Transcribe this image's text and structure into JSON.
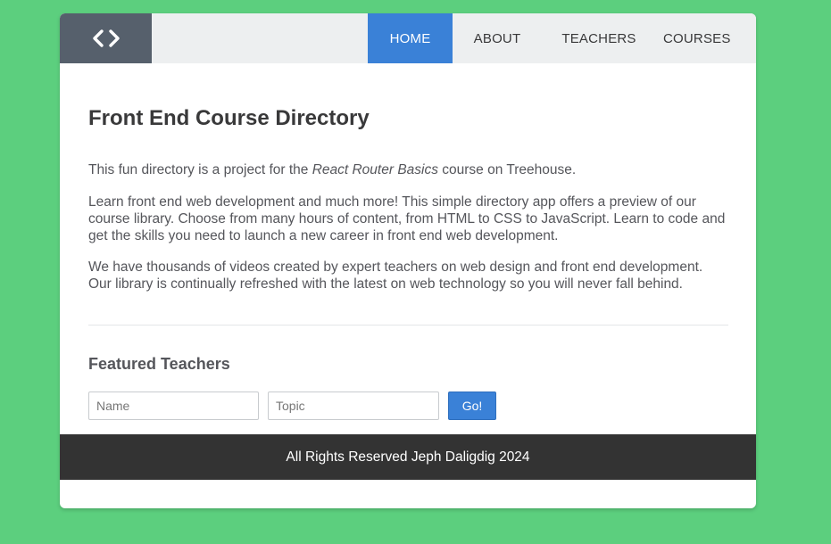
{
  "header": {
    "logo_icon": "code-brackets-icon",
    "nav": [
      {
        "label": "HOME",
        "active": true
      },
      {
        "label": "ABOUT",
        "active": false
      },
      {
        "label": "TEACHERS",
        "active": false
      },
      {
        "label": "COURSES",
        "active": false
      }
    ]
  },
  "main": {
    "title": "Front End Course Directory",
    "intro": {
      "before": "This fun directory is a project for the ",
      "emphasis": "React Router Basics",
      "after": " course on Treehouse."
    },
    "paragraph2": "Learn front end web development and much more! This simple directory app offers a preview of our course library. Choose from many hours of content, from HTML to CSS to JavaScript. Learn to code and get the skills you need to launch a new career in front end web development.",
    "paragraph3": "We have thousands of videos created by expert teachers on web design and front end development. Our library is continually refreshed with the latest on web technology so you will never fall behind.",
    "featured_title": "Featured Teachers",
    "form": {
      "name_placeholder": "Name",
      "topic_placeholder": "Topic",
      "submit_label": "Go!"
    }
  },
  "footer": {
    "text": "All Rights Reserved Jeph Daligdig 2024"
  },
  "colors": {
    "page_background": "#5ccf7e",
    "header_background": "#edeff0",
    "logo_background": "#56606c",
    "accent": "#3a81d7",
    "footer_background": "#333333"
  }
}
